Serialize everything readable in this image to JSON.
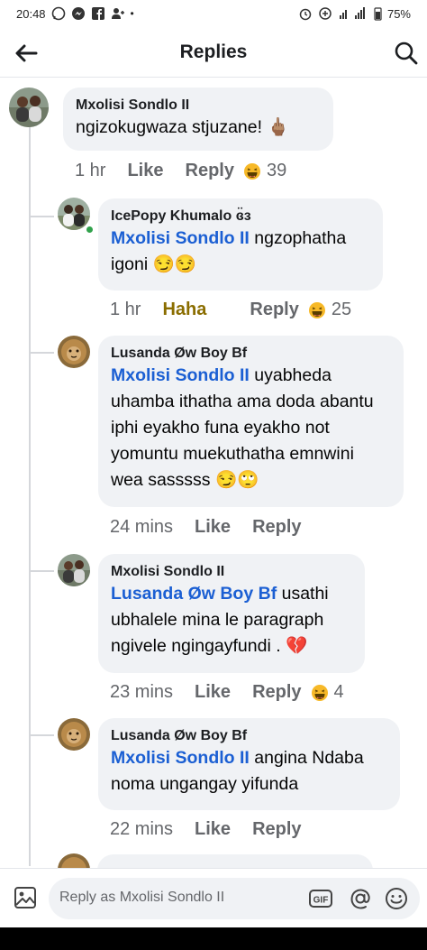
{
  "status_bar": {
    "time": "20:48",
    "battery": "75%"
  },
  "header": {
    "title": "Replies"
  },
  "parent_comment": {
    "author": "Mxolisi Sondlo II",
    "text": "ngizokugwaza stjuzane! 🖕🏽",
    "time": "1 hr",
    "like_label": "Like",
    "reply_label": "Reply",
    "reaction_count": "39"
  },
  "replies": [
    {
      "author": "IcePopy Khumalo ɞ̈ɜ",
      "mention": "Mxolisi Sondlo II",
      "text": " ngzophatha igoni 😏😏",
      "time": "1 hr",
      "like_label": "Haha",
      "reply_label": "Reply",
      "reaction_count": "25"
    },
    {
      "author": "Lusanda Øw Boy Bf",
      "mention": "Mxolisi Sondlo II",
      "text": " uyabheda uhamba ithatha ama doda abantu iphi eyakho funa eyakho not yomuntu muekuthatha emnwini wea sasssss 😏🙄",
      "time": "24 mins",
      "like_label": "Like",
      "reply_label": "Reply",
      "reaction_count": ""
    },
    {
      "author": "Mxolisi Sondlo II",
      "mention": "Lusanda Øw Boy Bf",
      "text": " usathi ubhalele mina le paragraph ngivele ngingayfundi . 💔",
      "time": "23 mins",
      "like_label": "Like",
      "reply_label": "Reply",
      "reaction_count": "4"
    },
    {
      "author": "Lusanda Øw Boy Bf",
      "mention": "Mxolisi Sondlo II",
      "text": " angina Ndaba noma ungangay yifunda",
      "time": "22 mins",
      "like_label": "Like",
      "reply_label": "Reply",
      "reaction_count": ""
    }
  ],
  "composer": {
    "placeholder": "Reply as Mxolisi Sondlo II",
    "gif_label": "GIF"
  },
  "icons": {
    "back": "arrow-left-icon",
    "search": "search-icon",
    "gallery": "image-icon",
    "gif": "gif-icon",
    "mention": "at-icon",
    "emoji": "smiley-icon",
    "reaction": "haha-reaction-icon"
  },
  "colors": {
    "mention": "#1b5fd3",
    "bubble": "#f0f2f5",
    "meta": "#65676b",
    "haha_active": "#8a6d00",
    "online": "#31a24c"
  }
}
